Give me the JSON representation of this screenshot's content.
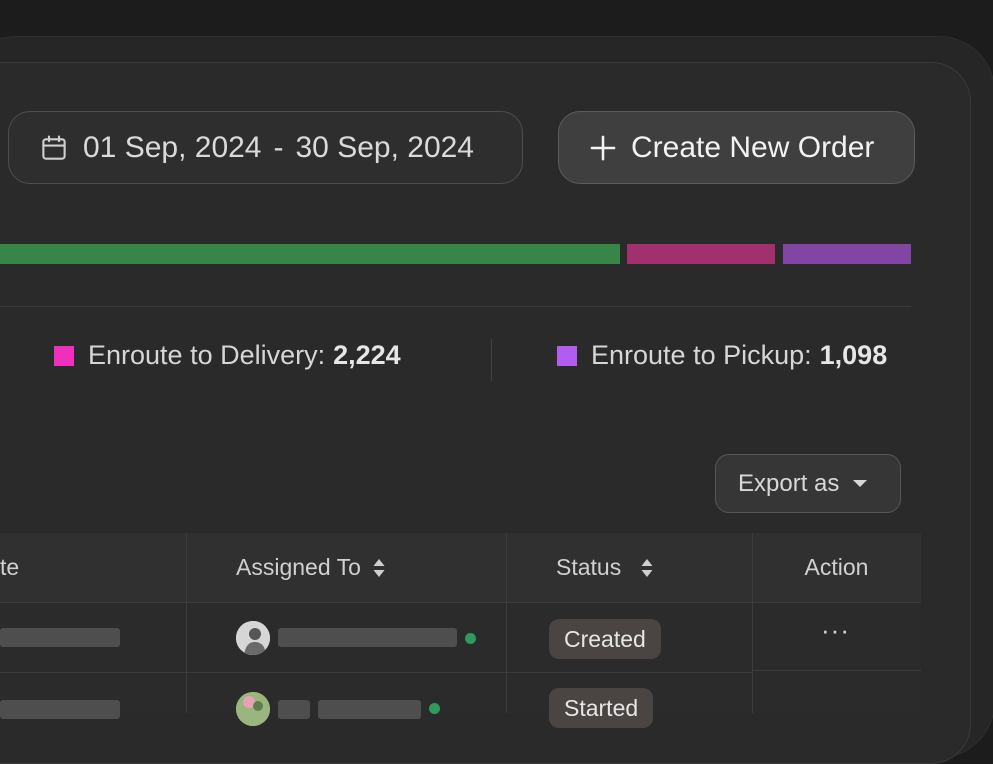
{
  "toolbar": {
    "date_start": "01 Sep, 2024",
    "date_separator": "-",
    "date_end": "30 Sep, 2024",
    "create_label": "Create New Order"
  },
  "status_bar": {
    "colors": {
      "delivered": "#38854a",
      "enroute_delivery": "#a1306f",
      "enroute_pickup": "#8145a4"
    }
  },
  "legend": [
    {
      "label": "Enroute to Delivery:",
      "value": "2,224",
      "color": "#ef2fbd"
    },
    {
      "label": "Enroute to Pickup:",
      "value": "1,098",
      "color": "#b25cf0"
    }
  ],
  "export": {
    "label": "Export as"
  },
  "table": {
    "columns": [
      {
        "label": "te"
      },
      {
        "label": "Assigned To"
      },
      {
        "label": "Status"
      },
      {
        "label": "Action"
      }
    ],
    "rows": [
      {
        "status": "Created",
        "action": "···"
      },
      {
        "status": "Started"
      }
    ]
  }
}
